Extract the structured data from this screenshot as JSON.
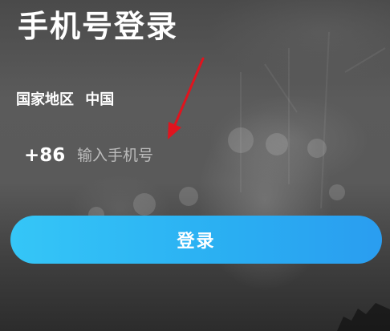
{
  "header": {
    "title": "手机号登录"
  },
  "region": {
    "label": "国家地区",
    "value": "中国"
  },
  "phone": {
    "country_code": "+86",
    "value": "",
    "placeholder": "输入手机号"
  },
  "actions": {
    "login_label": "登录"
  },
  "colors": {
    "button_start": "#35c6f7",
    "button_end": "#2a9df0",
    "annotation_arrow": "#e0141e",
    "text": "#ffffff"
  },
  "icons": {
    "annotation": "red-arrow-icon"
  }
}
